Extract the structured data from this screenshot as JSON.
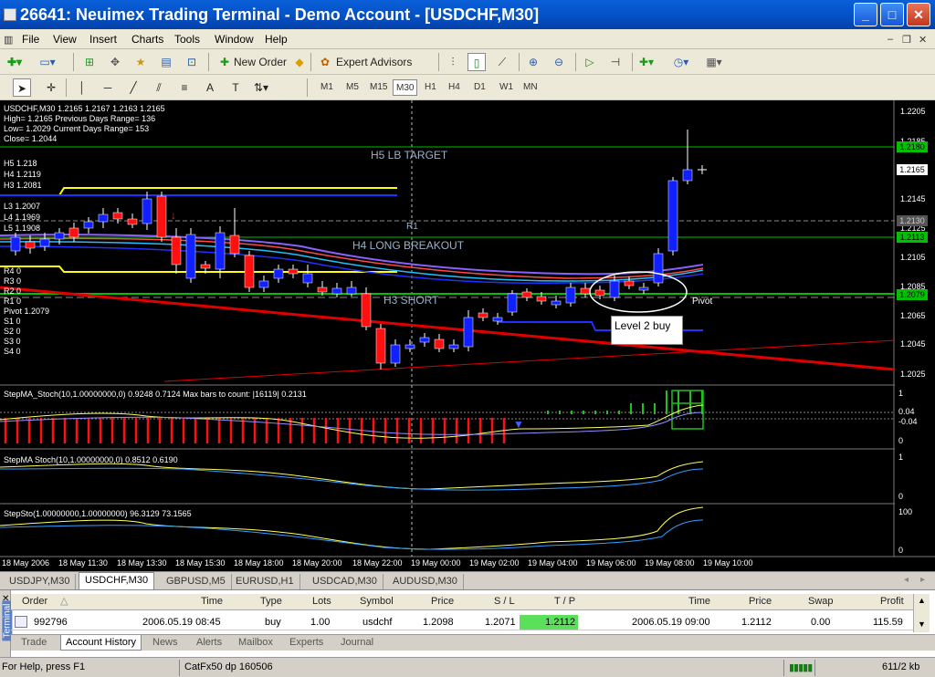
{
  "window": {
    "title": "26641: Neuimex Trading Terminal - Demo Account - [USDCHF,M30]"
  },
  "menu": [
    "File",
    "View",
    "Insert",
    "Charts",
    "Tools",
    "Window",
    "Help"
  ],
  "toolbar1": {
    "new_order": "New Order",
    "expert_advisors": "Expert Advisors"
  },
  "toolbar2": {
    "timeframes": [
      "M1",
      "M5",
      "M15",
      "M30",
      "H1",
      "H4",
      "D1",
      "W1",
      "MN"
    ],
    "selected_timeframe": "M30"
  },
  "chart": {
    "header_line": "USDCHF,M30  1.2165 1.2167 1.2163 1.2165",
    "info": [
      "High= 1.2165    Previous Days Range= 136",
      "Low= 1.2029    Current Days Range= 153",
      "Close= 1.2044"
    ],
    "levels_upper": [
      "H5 1.218",
      "H4 1.2119",
      "H3 1.2081"
    ],
    "levels_lower": [
      "L3 1.2007",
      "L4 1.1969",
      "L5 1.1908"
    ],
    "r_levels": [
      "R4 0",
      "R3 0",
      "R2 0",
      "R1 0"
    ],
    "pivot_text": "Pivot 1.2079",
    "s_levels": [
      "S1 0",
      "S2 0",
      "S3 0",
      "S4 0"
    ],
    "annotations": {
      "h5": "H5 LB TARGET",
      "r1": "R1",
      "h4": "H4 LONG BREAKOUT",
      "h3": "H3 SHORT",
      "pivot": "Pivot",
      "level2": "Level 2 buy"
    },
    "price_scale": [
      "1.2205",
      "1.2185",
      "1.2165",
      "1.2145",
      "1.2125",
      "1.2105",
      "1.2085",
      "1.2065",
      "1.2045",
      "1.2025"
    ],
    "price_badges": {
      "h5": "1.2180",
      "current": "1.2165",
      "r1": "1.2130",
      "h4": "1.2113",
      "pivot": "1.2079"
    },
    "ind1_label": "StepMA_Stoch(10,1.00000000,0) 0.9248 0.7124  Max bars to count: |16119|  0.2131",
    "ind1_scale": [
      "1",
      "0.04",
      "-0.04",
      "0"
    ],
    "ind2_label": "StepMA Stoch(10,1.00000000,0) 0.8512 0.6190",
    "ind2_scale": [
      "1",
      "0"
    ],
    "ind3_label": "StepSto(1.00000000,1.00000000) 96.3129 73.1565",
    "ind3_scale": [
      "100",
      "0"
    ],
    "time_axis": [
      "18 May 2006",
      "18 May 11:30",
      "18 May 13:30",
      "18 May 15:30",
      "18 May 18:00",
      "18 May 20:00",
      "18 May 22:00",
      "19 May 00:00",
      "19 May 02:00",
      "19 May 04:00",
      "19 May 06:00",
      "19 May 08:00",
      "19 May 10:00"
    ]
  },
  "chart_tabs": [
    "USDJPY,M30",
    "USDCHF,M30",
    "GBPUSD,M5",
    "EURUSD,H1",
    "USDCAD,M30",
    "AUDUSD,M30"
  ],
  "active_chart_tab": "USDCHF,M30",
  "terminal": {
    "side_label": "Terminal",
    "columns": [
      "Order",
      "Time",
      "Type",
      "Lots",
      "Symbol",
      "Price",
      "S / L",
      "T / P",
      "Time",
      "Price",
      "Swap",
      "Profit"
    ],
    "rows": [
      {
        "order": "992796",
        "open_time": "2006.05.19 08:45",
        "type": "buy",
        "lots": "1.00",
        "symbol": "usdchf",
        "price": "1.2098",
        "sl": "1.2071",
        "tp": "1.2112",
        "close_time": "2006.05.19 09:00",
        "close_price": "1.2112",
        "swap": "0.00",
        "profit": "115.59"
      }
    ],
    "tabs": [
      "Trade",
      "Account History",
      "News",
      "Alerts",
      "Mailbox",
      "Experts",
      "Journal"
    ],
    "active_tab": "Account History"
  },
  "status": {
    "help": "For Help, press F1",
    "profile": "CatFx50 dp 160506",
    "traffic": "611/2 kb"
  },
  "colors": {
    "bg": "#000000",
    "bull": "#0000ff",
    "bear": "#ff0000",
    "grid": "#7a7a7a",
    "green_line": "#00c000",
    "yellow": "#ffff00"
  }
}
